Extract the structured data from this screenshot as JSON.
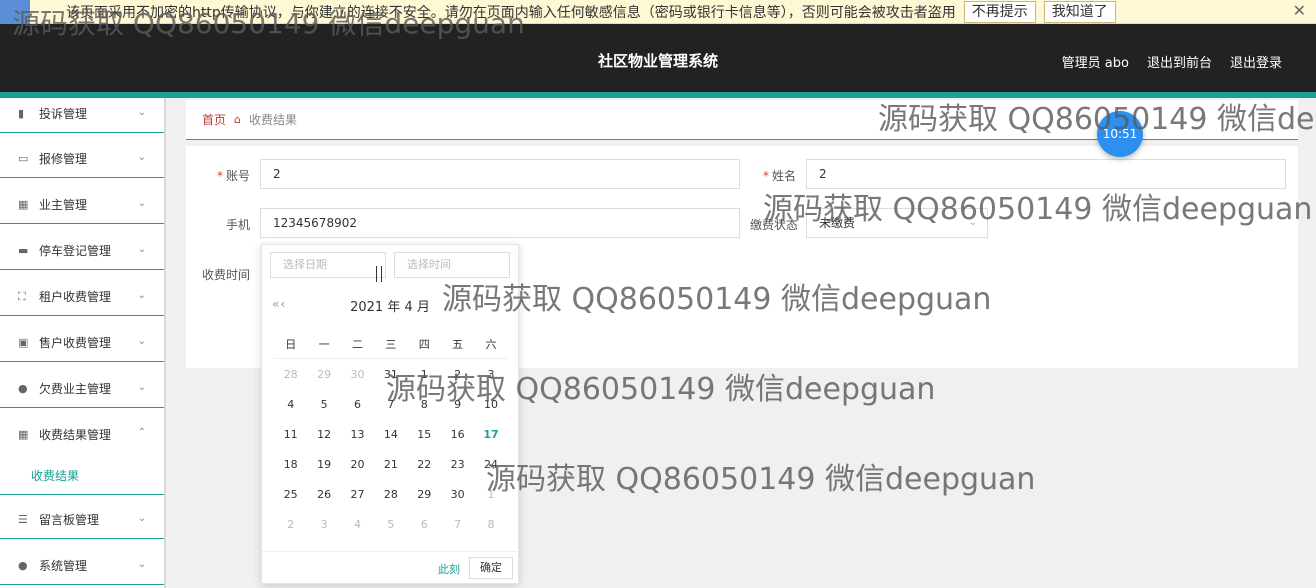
{
  "banner": {
    "text": "该页面采用不加密的http传输协议，与你建立的连接不安全。请勿在页面内输入任何敏感信息（密码或银行卡信息等），否则可能会被攻击者盗用",
    "no_remind": "不再提示",
    "got_it": "我知道了",
    "close": "✕"
  },
  "header": {
    "title": "社区物业管理系统",
    "admin": "管理员 abo",
    "to_front": "退出到前台",
    "logout": "退出登录"
  },
  "sidebar": {
    "items": [
      {
        "label": "投诉管理",
        "icon": "bar-chart-icon"
      },
      {
        "label": "报修管理",
        "icon": "message-icon"
      },
      {
        "label": "业主管理",
        "icon": "grid-icon"
      },
      {
        "label": "停车登记管理",
        "icon": "chat-icon"
      },
      {
        "label": "租户收费管理",
        "icon": "frame-icon"
      },
      {
        "label": "售户收费管理",
        "icon": "card-icon"
      },
      {
        "label": "欠费业主管理",
        "icon": "user-icon"
      },
      {
        "label": "收费结果管理",
        "icon": "apps-icon"
      },
      {
        "label": "留言板管理",
        "icon": "list-icon"
      },
      {
        "label": "系统管理",
        "icon": "bulb-icon"
      }
    ],
    "sub_item": "收费结果"
  },
  "breadcrumb": {
    "home": "首页",
    "current": "收费结果"
  },
  "form": {
    "account_label": "账号",
    "account_value": "2",
    "name_label": "姓名",
    "name_value": "2",
    "phone_label": "手机",
    "phone_value": "12345678902",
    "status_label": "缴费状态",
    "status_value": "未缴费",
    "time_label": "收费时间"
  },
  "picker": {
    "date_placeholder": "选择日期",
    "time_placeholder": "选择时间",
    "nav": "«‹",
    "month": "2021 年  4 月",
    "weekdays": [
      "日",
      "一",
      "二",
      "三",
      "四",
      "五",
      "六"
    ],
    "weeks": [
      [
        "28",
        "29",
        "30",
        "31",
        "1",
        "2",
        "3"
      ],
      [
        "4",
        "5",
        "6",
        "7",
        "8",
        "9",
        "10"
      ],
      [
        "11",
        "12",
        "13",
        "14",
        "15",
        "16",
        "17"
      ],
      [
        "18",
        "19",
        "20",
        "21",
        "22",
        "23",
        "24"
      ],
      [
        "25",
        "26",
        "27",
        "28",
        "29",
        "30",
        "1"
      ],
      [
        "2",
        "3",
        "4",
        "5",
        "6",
        "7",
        "8"
      ]
    ],
    "today": "17",
    "now": "此刻",
    "confirm": "确定"
  },
  "clock": "10:51",
  "watermark": "源码获取 QQ86050149 微信deepguan",
  "colors": {
    "accent": "#1aa094",
    "header_bg": "#222222",
    "required": "#e53935",
    "clock": "#2d8ff0"
  }
}
